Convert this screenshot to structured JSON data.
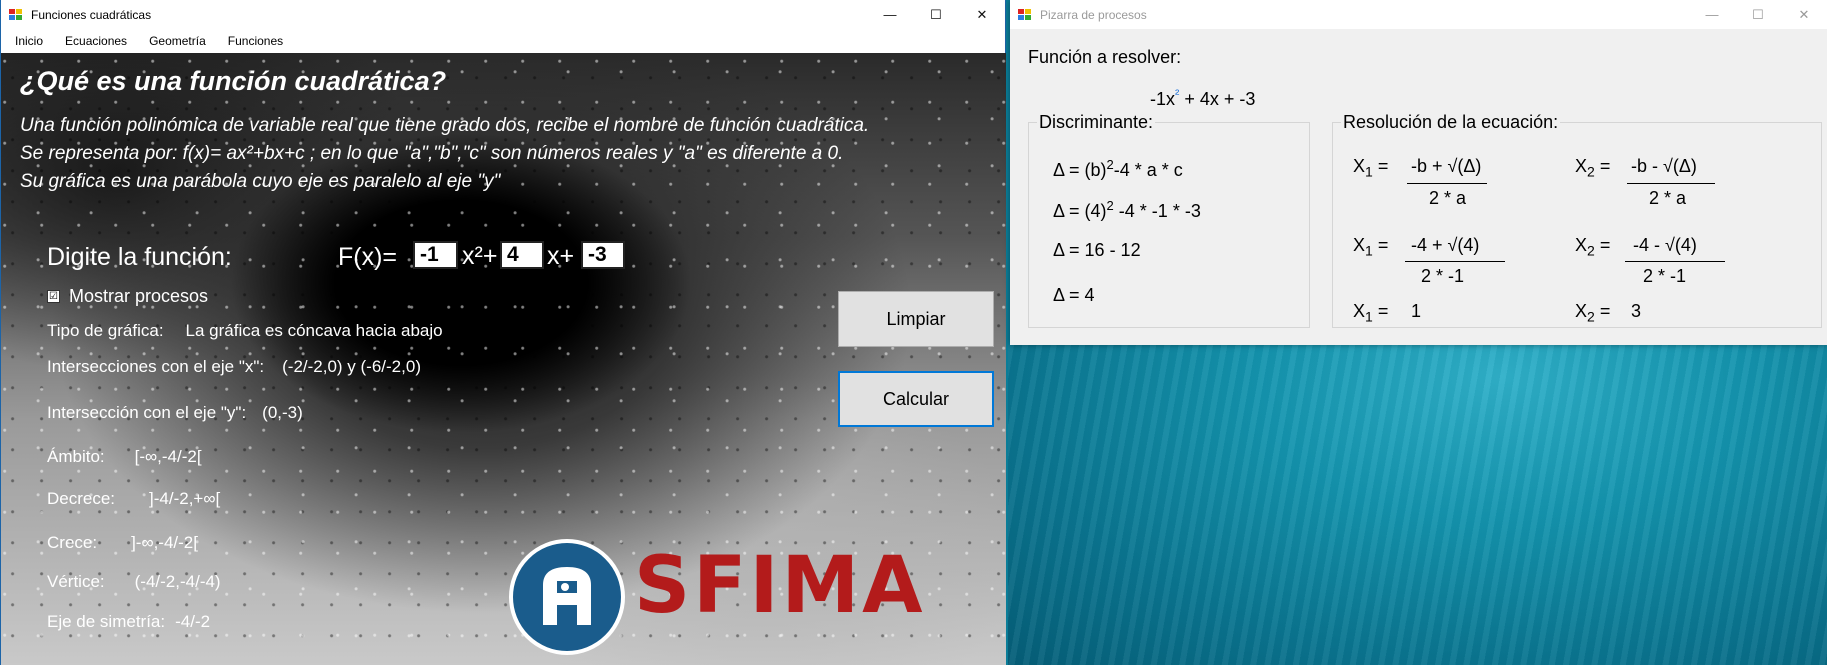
{
  "left_window": {
    "title": "Funciones cuadráticas",
    "window_controls": {
      "minimize": "—",
      "maximize": "☐",
      "close": "✕"
    },
    "menu": [
      "Inicio",
      "Ecuaciones",
      "Geometría",
      "Funciones"
    ],
    "heading": "¿Qué es una función cuadrática?",
    "description": [
      "Una función polinómica de variable real que tiene grado dos, recibe el nombre de función cuadrática.",
      "Se representa por: f(x)= ax²+bx+c ; en lo que \"a\",\"b\",\"c\" son números reales y \"a\" es diferente a 0.",
      "Su gráfica es una parábola cuyo eje es paralelo al eje \"y\""
    ],
    "digite_label": "Digite la función:",
    "fx_label": "F(x)=",
    "coef_a": "-1",
    "x2_op": "x²+",
    "coef_b": "4",
    "x_op": "x+",
    "coef_c": "-3",
    "show_process_label": "Mostrar procesos",
    "show_process_checked": "☑",
    "tipo_label": "Tipo de gráfica:",
    "tipo_value": "La gráfica es cóncava hacia abajo",
    "inter_x_label": "Intersecciones con el eje \"x\":",
    "inter_x_value": "(-2/-2,0) y (-6/-2,0)",
    "inter_y_label": "Intersección con el eje \"y\":",
    "inter_y_value": "(0,-3)",
    "ambito_label": "Ámbito:",
    "ambito_value": "[-∞,-4/-2[",
    "decrece_label": "Decrece:",
    "decrece_value": "]-4/-2,+∞[",
    "crece_label": "Crece:",
    "crece_value": "]-∞,-4/-2[",
    "vertice_label": "Vértice:",
    "vertice_value": "(-4/-2,-4/-4)",
    "eje_label": "Eje de simetría:",
    "eje_value": "-4/-2",
    "btn_limpiar": "Limpiar",
    "btn_calcular": "Calcular",
    "logo_text": "SFIMA"
  },
  "right_window": {
    "title": "Pizarra de procesos",
    "window_controls": {
      "minimize": "—",
      "maximize": "☐",
      "close": "✕"
    },
    "funcion_label": "Función a resolver:",
    "funcion_value_a": "-1x",
    "funcion_value_sup": "²",
    "funcion_value_rest": "+ 4x + -3",
    "disc_group": "Discriminante:",
    "disc_line1": "Δ = (b)",
    "disc_line1_sup": "2",
    "disc_line1_rest": "-4 * a * c",
    "disc_line2": "Δ = (4)",
    "disc_line2_sup": "2",
    "disc_line2_rest": "-4 * -1 * -3",
    "disc_line3": "Δ = 16 - 12",
    "disc_line4": "Δ = 4",
    "res_group": "Resolución de la ecuación:",
    "x1_label": "X",
    "x1_sub": "1",
    "x2_sub": "2",
    "eq": "=",
    "x1_num1": "-b + √(Δ)",
    "x1_den1": "2 * a",
    "x2_num1": "-b - √(Δ)",
    "x2_den1": "2 * a",
    "x1_num2": "-4 + √(4)",
    "x1_den2": "2 * -1",
    "x2_num2": "-4 - √(4)",
    "x2_den2": "2 * -1",
    "x1_result": "1",
    "x2_result": "3"
  }
}
